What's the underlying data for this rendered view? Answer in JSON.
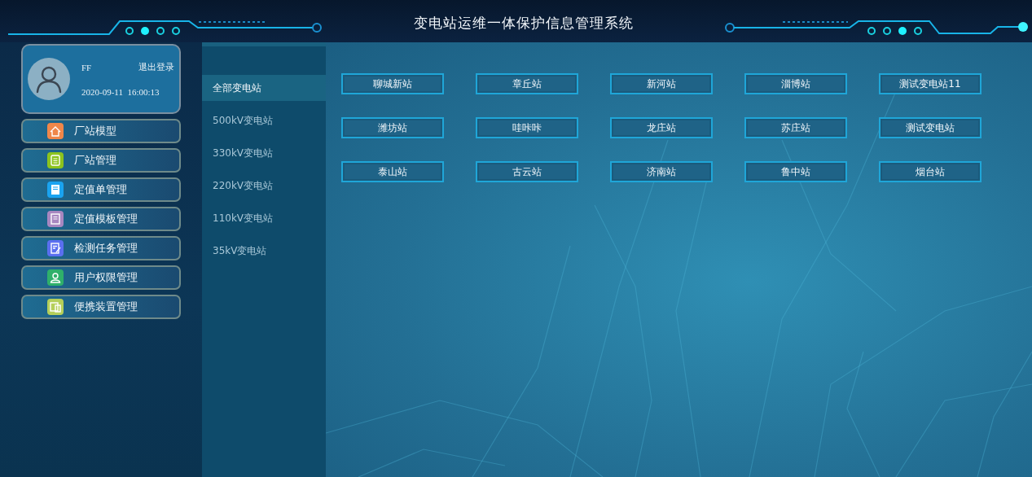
{
  "window": {
    "title": "变电站运维一体保护信息管理系统"
  },
  "user": {
    "name": "FF",
    "logout": "退出登录",
    "time": "2020-09-11  16:00:13"
  },
  "nav": [
    {
      "label": "厂站模型",
      "color": "#f0874a"
    },
    {
      "label": "厂站管理",
      "color": "#8cc31e"
    },
    {
      "label": "定值单管理",
      "color": "#1aa3f0"
    },
    {
      "label": "定值模板管理",
      "color": "#a887c0"
    },
    {
      "label": "检测任务管理",
      "color": "#5b6ff0"
    },
    {
      "label": "用户权限管理",
      "color": "#2fb06a"
    },
    {
      "label": "便携装置管理",
      "color": "#b5cf5a"
    }
  ],
  "categories": [
    {
      "label": "全部变电站",
      "selected": true
    },
    {
      "label": "500kV变电站",
      "selected": false
    },
    {
      "label": "330kV变电站",
      "selected": false
    },
    {
      "label": "220kV变电站",
      "selected": false
    },
    {
      "label": "110kV变电站",
      "selected": false
    },
    {
      "label": "35kV变电站",
      "selected": false
    }
  ],
  "stations": [
    "聊城新站",
    "章丘站",
    "新河站",
    "淄博站",
    "测试变电站11",
    "潍坊站",
    "哇咔咔",
    "龙庄站",
    "苏庄站",
    "测试变电站",
    "泰山站",
    "古云站",
    "济南站",
    "鲁中站",
    "烟台站"
  ]
}
